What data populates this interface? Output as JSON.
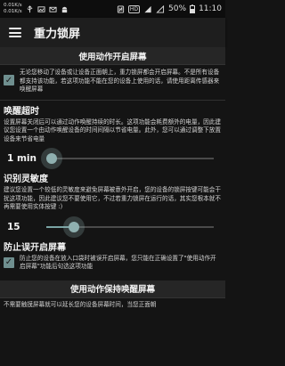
{
  "status_bar": {
    "speed_up": "0.01K/s",
    "speed_down": "0.01K/s",
    "hd": "HD",
    "battery": "50%",
    "time": "11:10"
  },
  "app_bar": {
    "title": "重力锁屏"
  },
  "sections": {
    "motion_unlock": {
      "header": "使用动作开启屏幕",
      "checked": true,
      "desc": "无论您移动了设备或让设备正面朝上，重力锁屏都会开启屏幕。不是所有设备都支持该功能，若这项功能不能在您的设备上使用的话，请使用距离传感器来唤醒屏幕"
    },
    "wake_timeout": {
      "title": "唤醒超时",
      "desc": "设置屏幕关闭后可以通过动作唤醒持续的时长。这项功能会耗费额外的电量，因此建议您设置一个由动作唤醒设备的时间间隔以节省电量。此外，您可以通过调整下放置设备来节省电量",
      "value_label": "1 min",
      "value_fraction": 0.0
    },
    "sensitivity": {
      "title": "识别灵敏度",
      "desc": "建议您设置一个较低的灵敏度来避免屏幕被意外开启，您的设备的锁屏按键可能会干扰这项功能，因此建议您不要使用它，不过若重力锁屏在运行的话，其实您根本就不再需要使用实体按键 :)",
      "value_label": "15",
      "value_fraction": 0.14
    },
    "prevent_accidental": {
      "title": "防止误开启屏幕",
      "checked": true,
      "desc": "防止您的设备在放入口袋时被误开启屏幕，您只能在正确设置了\"使用动作开启屏幕\"功能后句选这项功能"
    },
    "motion_keep_awake": {
      "header": "使用动作保持唤醒屏幕",
      "desc": "不需要触摸屏幕就可以延长您的设备屏幕时间，当您正面朝"
    }
  },
  "colors": {
    "accent": "#8fb0b0",
    "checkbox": "#6f8f8f",
    "background": "#141414",
    "appbar": "#1e1e1e"
  }
}
